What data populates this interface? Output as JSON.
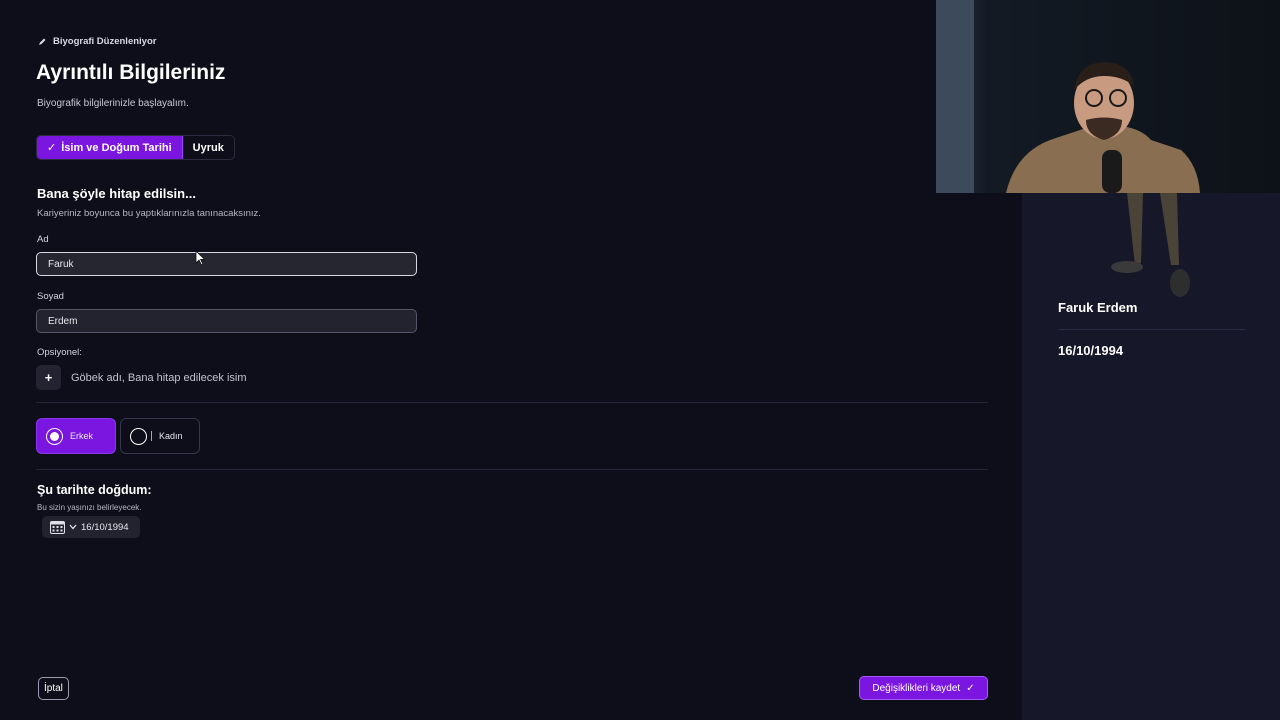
{
  "breadcrumb": {
    "text": "Biyografi Düzenleniyor"
  },
  "header": {
    "title": "Ayrıntılı Bilgileriniz",
    "subtitle": "Biyografik bilgilerinizle başlayalım."
  },
  "tabs": [
    {
      "label": "İsim ve Doğum Tarihi",
      "active": true
    },
    {
      "label": "Uyruk",
      "active": false
    }
  ],
  "name_section": {
    "title": "Bana şöyle hitap edilsin...",
    "description": "Kariyeriniz boyunca bu yaptıklarınızla tanınacaksınız.",
    "first_name": {
      "label": "Ad",
      "value": "Faruk"
    },
    "last_name": {
      "label": "Soyad",
      "value": "Erdem"
    },
    "optional_label": "Opsiyonel:",
    "optional_add": {
      "icon": "plus-icon",
      "text": "Göbek adı, Bana hitap edilecek isim"
    }
  },
  "gender": {
    "options": [
      {
        "label": "Erkek",
        "selected": true
      },
      {
        "label": "Kadın",
        "selected": false
      }
    ]
  },
  "birth_date": {
    "title": "Şu tarihte doğdum:",
    "description": "Bu sizin yaşınızı belirleyecek.",
    "value": "16/10/1994",
    "icon": "calendar-icon"
  },
  "footer": {
    "cancel_label": "İptal",
    "save_label": "Değişiklikleri kaydet"
  },
  "profile_preview": {
    "name": "Faruk Erdem",
    "birth_date": "16/10/1994"
  },
  "colors": {
    "accent": "#7b16e0",
    "background": "#0e0e1a",
    "side_panel": "#17172a"
  }
}
